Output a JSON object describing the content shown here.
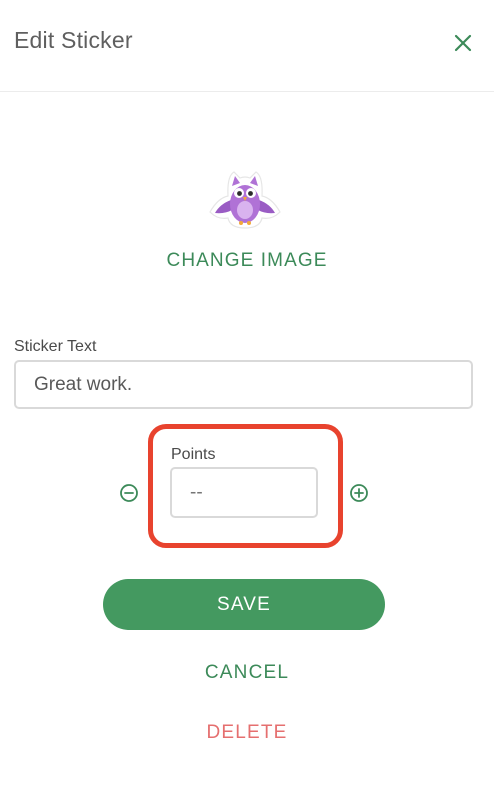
{
  "header": {
    "title": "Edit Sticker",
    "close_icon": "close-icon"
  },
  "sticker": {
    "image_icon": "owl-sticker-icon",
    "change_image_label": "CHANGE IMAGE"
  },
  "sticker_text": {
    "label": "Sticker Text",
    "value": "Great work."
  },
  "points": {
    "label": "Points",
    "placeholder": "--",
    "decrement_icon": "minus-circle-icon",
    "increment_icon": "plus-circle-icon"
  },
  "actions": {
    "save_label": "SAVE",
    "cancel_label": "CANCEL",
    "delete_label": "DELETE"
  },
  "colors": {
    "accent_green": "#449960",
    "text_green": "#3c8a59",
    "danger_red": "#e56f6f",
    "highlight_red": "#e8432e",
    "owl_purple": "#b072d6"
  }
}
